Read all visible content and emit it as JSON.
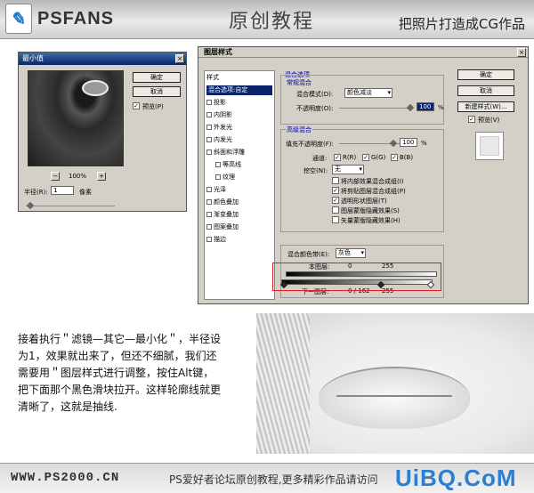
{
  "banner": {
    "logo_text": "PSFANS",
    "title": "原创教程",
    "subtitle": "把照片打造成CG作品"
  },
  "min_filter": {
    "title": "最小值",
    "ok": "确定",
    "cancel": "取消",
    "preview": "预览(P)",
    "zoom": "100%",
    "radius_label": "半径(R):",
    "radius_value": "1",
    "unit": "像素",
    "minus": "−",
    "plus": "+"
  },
  "layer_style": {
    "title": "图层样式",
    "list": [
      {
        "label": "样式",
        "check": false
      },
      {
        "label": "混合选项:自定",
        "check": false
      },
      {
        "label": "投影",
        "check": true
      },
      {
        "label": "内阴影",
        "check": true
      },
      {
        "label": "外发光",
        "check": true
      },
      {
        "label": "内发光",
        "check": true
      },
      {
        "label": "斜面和浮雕",
        "check": true
      },
      {
        "label": "等高线",
        "check": true
      },
      {
        "label": "纹理",
        "check": true
      },
      {
        "label": "光泽",
        "check": true
      },
      {
        "label": "颜色叠加",
        "check": true
      },
      {
        "label": "渐变叠加",
        "check": true
      },
      {
        "label": "图案叠加",
        "check": true
      },
      {
        "label": "描边",
        "check": true
      }
    ],
    "blend_options": "混合选项",
    "general_blending": "常规混合",
    "blend_mode_label": "混合模式(D):",
    "blend_mode_value": "颜色减淡",
    "opacity_label": "不透明度(O):",
    "opacity_value": "100",
    "percent": "%",
    "advanced_blending": "高级混合",
    "fill_opacity_label": "填充不透明度(F):",
    "fill_opacity_value": "100",
    "channels_label": "通道:",
    "channel_r": "R(R)",
    "channel_g": "G(G)",
    "channel_b": "B(B)",
    "knockout_label": "挖空(N):",
    "knockout_value": "无",
    "adv_opts": [
      "将内部效果混合成组(I)",
      "将剪贴图层混合成组(P)",
      "透明形状图层(T)",
      "图层蒙版隐藏效果(S)",
      "矢量蒙版隐藏效果(H)"
    ],
    "blend_if_label": "混合颜色带(E):",
    "blend_if_value": "灰色",
    "this_layer_label": "本图层:",
    "this_layer_low": "0",
    "this_layer_high": "255",
    "underlying_label": "下一图层:",
    "underlying_value": "0 / 162",
    "underlying_high": "255",
    "ok": "确定",
    "cancel": "取消",
    "new_style": "新建样式(W)...",
    "preview": "预览(V)"
  },
  "description": "接着执行＂滤镜—其它—最小化＂，半径设为1，效果就出来了，但还不细腻，我们还需要用＂图层样式进行调整，按住Alt键，把下面那个黑色滑块拉开。这样轮廓线就更清晰了，这就是抽线.",
  "footer": {
    "site": "WWW.PS2000.CN",
    "text": "PS爱好者论坛原创教程,更多精彩作品请访问",
    "watermark": "UiBQ.CoM"
  }
}
